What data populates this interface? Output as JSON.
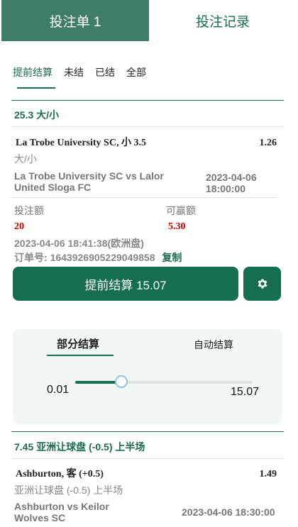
{
  "top_tabs": {
    "bet_slip": "投注单 1",
    "bet_history": "投注记录"
  },
  "sub_tabs": [
    "提前结算",
    "未结",
    "已结",
    "全部"
  ],
  "bet1": {
    "header": "25.3 大/小",
    "selection": "La Trobe University SC, 小 3.5",
    "odds": "1.26",
    "market": "大/小",
    "match": "La Trobe University SC vs Lalor United Sloga FC",
    "match_date": "2023-04-06",
    "match_time": "18:00:00",
    "stake_label": "投注额",
    "win_label": "可赢额",
    "stake": "20",
    "potential_win": "5.30",
    "placed_time": "2023-04-06 18:41:38(欧洲盘)",
    "order_label": "订单号:",
    "order_no": "1643926905229049858",
    "copy_label": "复制",
    "cashout_label": "提前结算 15.07",
    "partial": {
      "tab_partial": "部分结算",
      "tab_auto": "自动结算",
      "min": "0.01",
      "max": "15.07",
      "slider_fraction": 0.26
    }
  },
  "bet2": {
    "header": "7.45 亚洲让球盘 (-0.5) 上半场",
    "selection": "Ashburton, 客 (+0.5)",
    "odds": "1.49",
    "market": "亚洲让球盘 (-0.5) 上半场",
    "match": "Ashburton vs Keilor Wolves SC",
    "match_datetime": "2023-04-06 18:30:00"
  },
  "colors": {
    "brand_green": "#156e4f",
    "active_tab": "#3f7d66",
    "stake_red": "#d20000",
    "panel_bg": "#f1f8f4"
  },
  "icons": {
    "settings": "gear-icon"
  }
}
